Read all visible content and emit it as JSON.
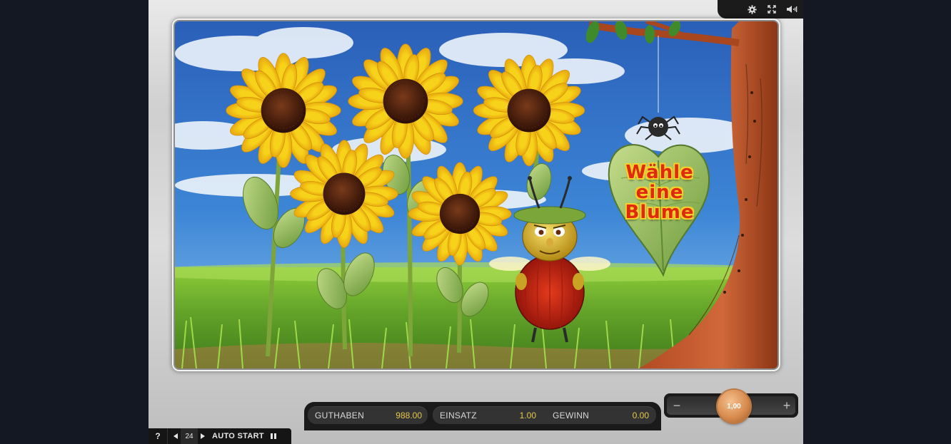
{
  "toolbar": {
    "icons": [
      "gear-icon",
      "fullscreen-icon",
      "speaker-icon"
    ]
  },
  "game": {
    "prompt_line1": "Wähle",
    "prompt_line2": "eine",
    "prompt_line3": "Blume"
  },
  "status": {
    "guthaben_label": "GUTHABEN",
    "guthaben_value": "988.00",
    "einsatz_label": "EINSATZ",
    "einsatz_value": "1.00",
    "gewinn_label": "GEWINN",
    "gewinn_value": "0.00"
  },
  "stake": {
    "minus": "−",
    "plus": "+",
    "chip_value": "1,00"
  },
  "controls": {
    "help": "?",
    "lines": "24",
    "autostart": "AUTO START",
    "prev_icon": "triangle-left-icon",
    "next_icon": "triangle-right-icon",
    "pause_icon": "pause-icon"
  },
  "colors": {
    "accent_value": "#e7c84a",
    "panel": "#1a1a1a"
  }
}
